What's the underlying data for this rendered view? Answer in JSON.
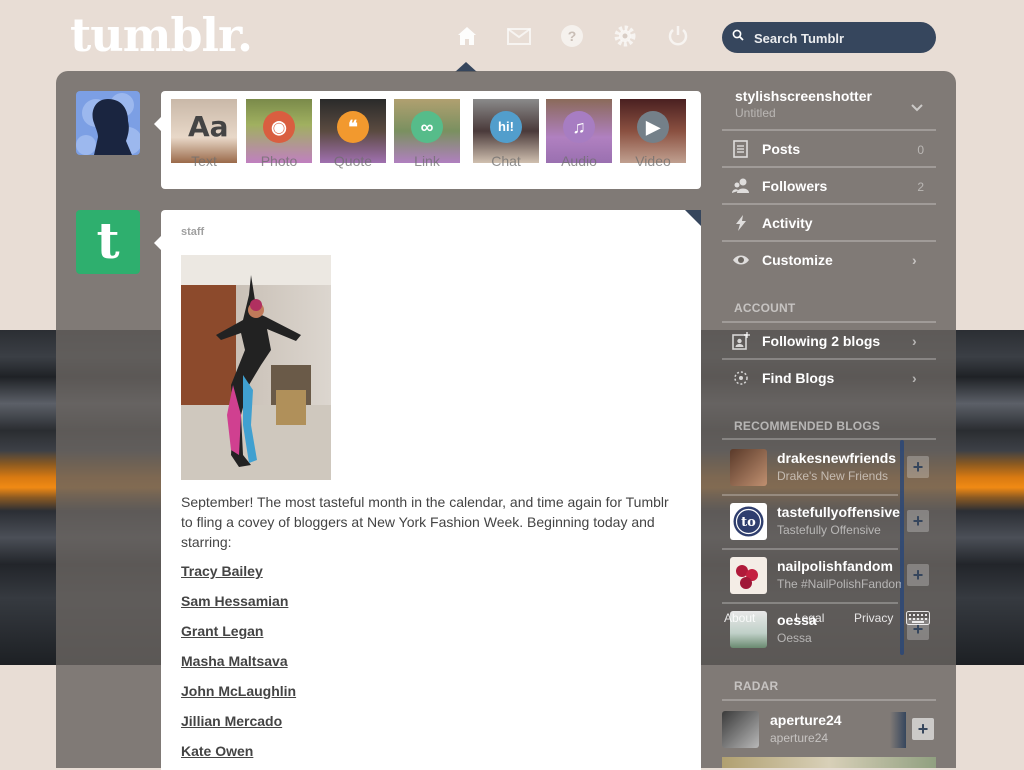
{
  "header": {
    "logo": "tumblr.",
    "search_placeholder": "Search Tumblr",
    "nav_icons": [
      "home-icon",
      "mail-icon",
      "help-icon",
      "gear-icon",
      "power-icon"
    ]
  },
  "composer": {
    "types": [
      {
        "label": "Text",
        "glyph": "Aa",
        "color": "#444444"
      },
      {
        "label": "Photo",
        "glyph": "◉",
        "color": "#d95e40"
      },
      {
        "label": "Quote",
        "glyph": "❝",
        "color": "#f2992e"
      },
      {
        "label": "Link",
        "glyph": "∞",
        "color": "#56bc8a"
      },
      {
        "label": "Chat",
        "glyph": "hi!",
        "color": "#529ecc"
      },
      {
        "label": "Audio",
        "glyph": "♫",
        "color": "#a77dc2"
      },
      {
        "label": "Video",
        "glyph": "▶",
        "color": "#748089"
      }
    ]
  },
  "post": {
    "author": "staff",
    "body": "September! The most tasteful month in the calendar, and time again for Tumblr to fling a covey of bloggers at New York Fashion Week. Beginning today and starring:",
    "links": [
      "Tracy Bailey",
      "Sam Hessamian",
      "Grant Legan",
      "Masha Maltsava",
      "John McLaughlin",
      "Jillian Mercado",
      "Kate Owen"
    ]
  },
  "sidebar": {
    "blog": {
      "name": "stylishscreenshotter",
      "subtitle": "Untitled"
    },
    "menu": [
      {
        "label": "Posts",
        "count": "0",
        "icon": "posts-icon"
      },
      {
        "label": "Followers",
        "count": "2",
        "icon": "followers-icon"
      },
      {
        "label": "Activity",
        "count": "",
        "icon": "lightning-icon"
      },
      {
        "label": "Customize",
        "count": "",
        "icon": "eye-icon"
      }
    ],
    "account_heading": "ACCOUNT",
    "account_items": [
      {
        "label": "Following 2 blogs",
        "icon": "following-icon"
      },
      {
        "label": "Find Blogs",
        "icon": "find-blogs-icon"
      }
    ],
    "recommended_heading": "RECOMMENDED BLOGS",
    "recommended": [
      {
        "name": "drakesnewfriends",
        "subtitle": "Drake's New Friends"
      },
      {
        "name": "tastefullyoffensive",
        "subtitle": "Tastefully Offensive"
      },
      {
        "name": "nailpolishfandom",
        "subtitle": "The #NailPolishFandom"
      },
      {
        "name": "oessa",
        "subtitle": "Oessa"
      }
    ],
    "footer_links": [
      "About",
      "Legal",
      "Privacy"
    ],
    "radar_heading": "RADAR",
    "radar": {
      "name": "aperture24",
      "subtitle": "aperture24"
    }
  },
  "colors": {
    "navy": "#36465d",
    "tumblr_green": "#2eaf6e",
    "panel": "#69645f",
    "page_bg": "#e8ddd5"
  }
}
